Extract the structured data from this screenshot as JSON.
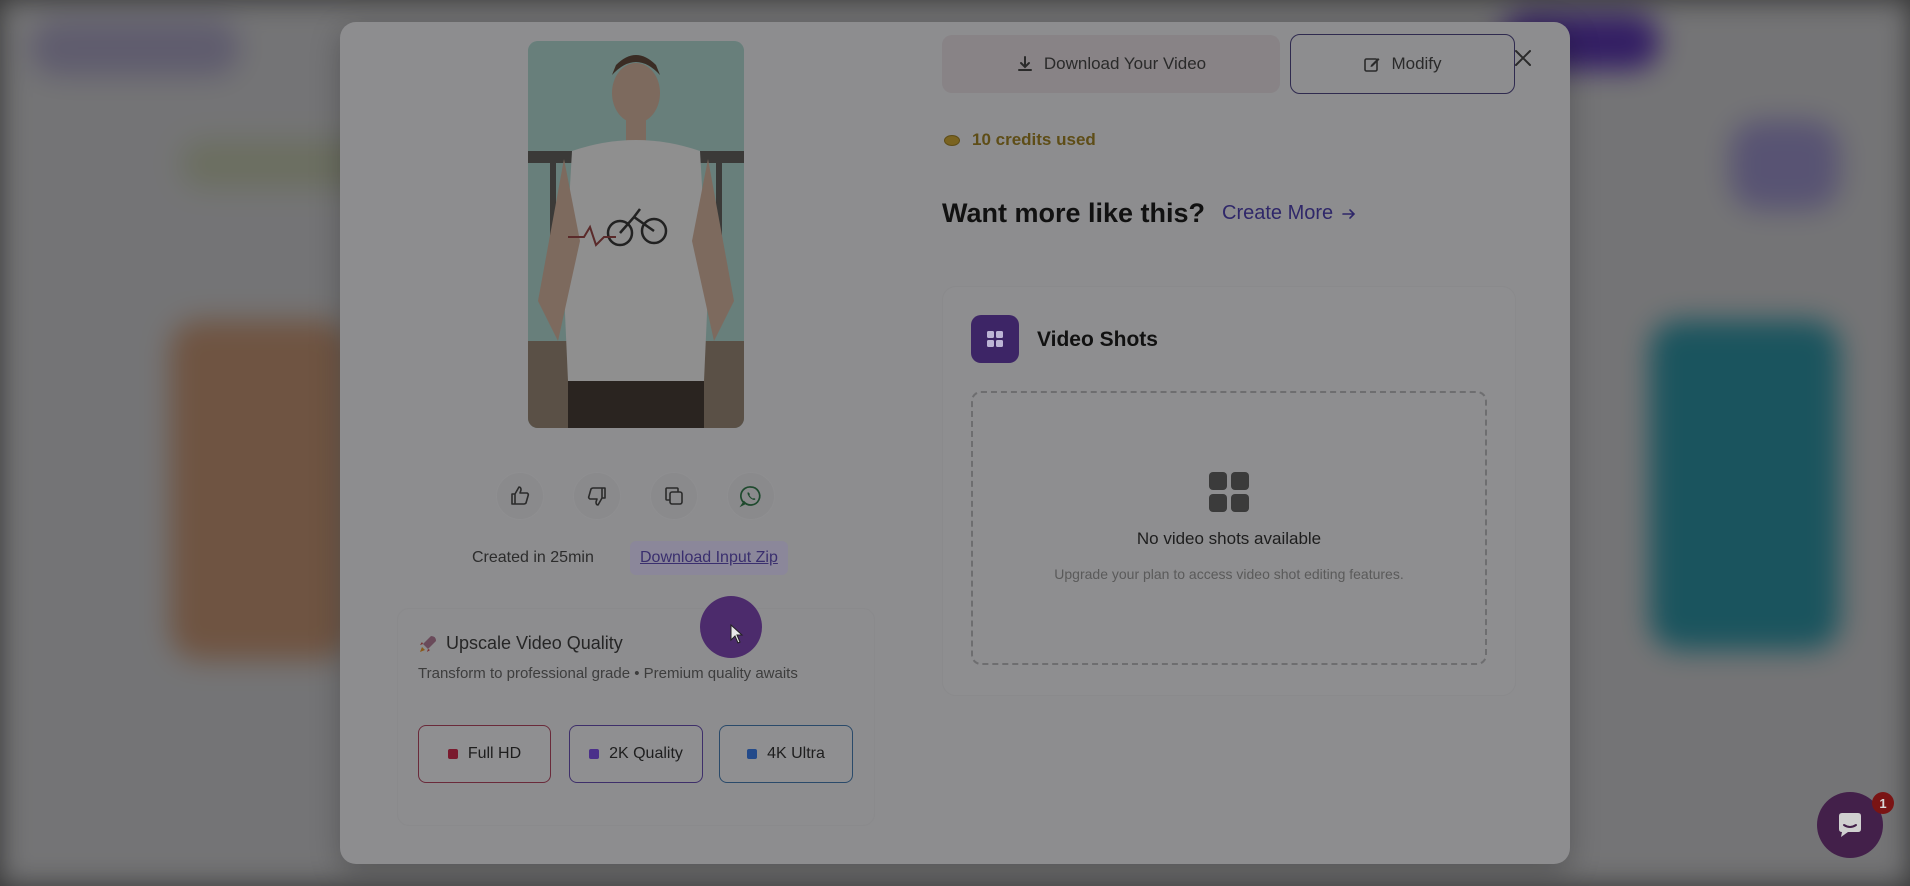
{
  "modal": {
    "download_label": "Download Your Video",
    "modify_label": "Modify",
    "credits_label": "10 credits used",
    "want_more_label": "Want more like this?",
    "create_more_label": "Create More",
    "created_text": "Created in 25min",
    "download_zip_label": "Download Input Zip",
    "upscale": {
      "title": "Upscale Video Quality",
      "subtitle": "Transform to professional grade • Premium quality awaits",
      "options": [
        {
          "label": "Full HD",
          "color": "#7a1a2e"
        },
        {
          "label": "2K Quality",
          "color": "#4a2f8a"
        },
        {
          "label": "4K Ultra",
          "color": "#234a8a"
        }
      ]
    },
    "video_shots": {
      "title": "Video Shots",
      "empty_title": "No video shots available",
      "empty_subtitle": "Upgrade your plan to access video shot editing features."
    }
  },
  "chat": {
    "badge": "1"
  },
  "colors": {
    "accent": "#3d2566",
    "overlay": "rgba(0,0,0,0.52)"
  }
}
